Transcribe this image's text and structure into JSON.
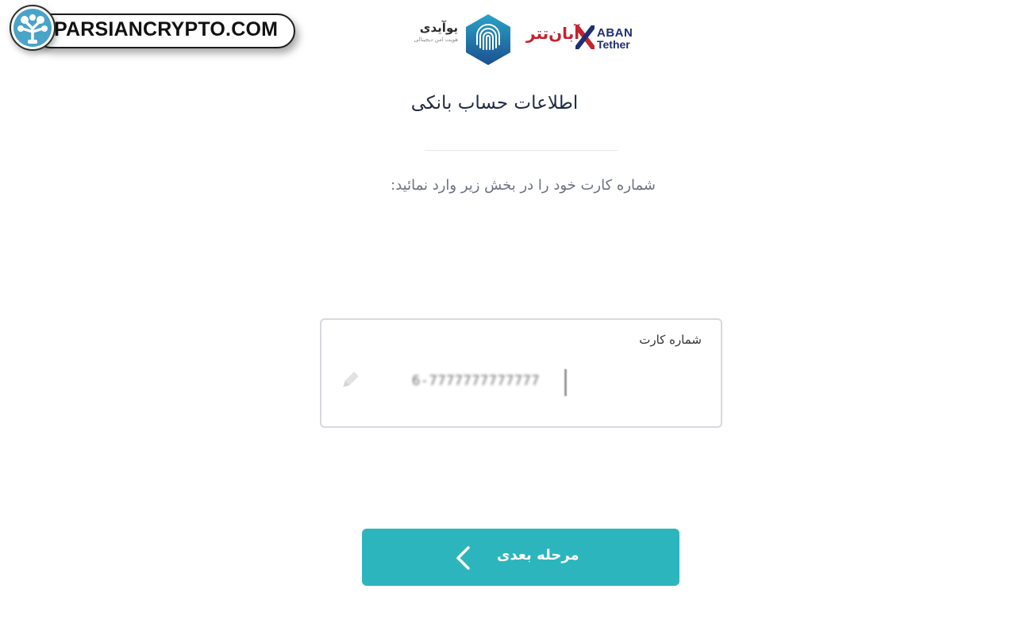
{
  "watermark": {
    "text": "PARSIANCRYPTO.COM"
  },
  "logos": {
    "uid_title": "یوآیدی",
    "uid_subtitle": "هویت امن دیجیتالی",
    "aban_fa": "آبان‌تتر",
    "aban_en_line1": "ABAN",
    "aban_en_line2": "Tether"
  },
  "page": {
    "title": "اطلاعات حساب بانکی",
    "subtitle": "شماره کارت خود را در بخش زیر وارد نمائید:"
  },
  "card_field": {
    "label": "شماره کارت",
    "value": "6-7777777777777"
  },
  "next_button": {
    "label": "مرحله بعدی"
  },
  "colors": {
    "accent": "#2db5bd",
    "title": "#1f2a44",
    "aban_red": "#c4232f",
    "aban_navy": "#1f2f72",
    "uid_hex_top": "#29a3c7",
    "uid_hex_bottom": "#1c4f8f"
  },
  "icons": {
    "watermark_logo": "tree-network-icon",
    "uid_logo": "fingerprint-hexagon-icon",
    "aban_logo": "x-mark-icon",
    "field_edit": "pencil-icon",
    "next": "chevron-left-icon"
  }
}
